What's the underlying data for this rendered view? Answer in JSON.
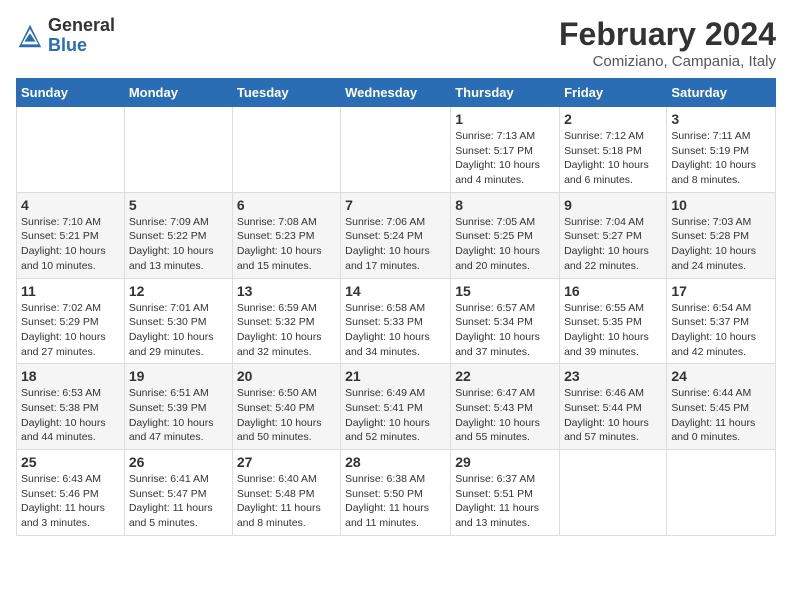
{
  "logo": {
    "general": "General",
    "blue": "Blue"
  },
  "header": {
    "title": "February 2024",
    "subtitle": "Comiziano, Campania, Italy"
  },
  "weekdays": [
    "Sunday",
    "Monday",
    "Tuesday",
    "Wednesday",
    "Thursday",
    "Friday",
    "Saturday"
  ],
  "weeks": [
    [
      {
        "day": "",
        "info": ""
      },
      {
        "day": "",
        "info": ""
      },
      {
        "day": "",
        "info": ""
      },
      {
        "day": "",
        "info": ""
      },
      {
        "day": "1",
        "info": "Sunrise: 7:13 AM\nSunset: 5:17 PM\nDaylight: 10 hours\nand 4 minutes."
      },
      {
        "day": "2",
        "info": "Sunrise: 7:12 AM\nSunset: 5:18 PM\nDaylight: 10 hours\nand 6 minutes."
      },
      {
        "day": "3",
        "info": "Sunrise: 7:11 AM\nSunset: 5:19 PM\nDaylight: 10 hours\nand 8 minutes."
      }
    ],
    [
      {
        "day": "4",
        "info": "Sunrise: 7:10 AM\nSunset: 5:21 PM\nDaylight: 10 hours\nand 10 minutes."
      },
      {
        "day": "5",
        "info": "Sunrise: 7:09 AM\nSunset: 5:22 PM\nDaylight: 10 hours\nand 13 minutes."
      },
      {
        "day": "6",
        "info": "Sunrise: 7:08 AM\nSunset: 5:23 PM\nDaylight: 10 hours\nand 15 minutes."
      },
      {
        "day": "7",
        "info": "Sunrise: 7:06 AM\nSunset: 5:24 PM\nDaylight: 10 hours\nand 17 minutes."
      },
      {
        "day": "8",
        "info": "Sunrise: 7:05 AM\nSunset: 5:25 PM\nDaylight: 10 hours\nand 20 minutes."
      },
      {
        "day": "9",
        "info": "Sunrise: 7:04 AM\nSunset: 5:27 PM\nDaylight: 10 hours\nand 22 minutes."
      },
      {
        "day": "10",
        "info": "Sunrise: 7:03 AM\nSunset: 5:28 PM\nDaylight: 10 hours\nand 24 minutes."
      }
    ],
    [
      {
        "day": "11",
        "info": "Sunrise: 7:02 AM\nSunset: 5:29 PM\nDaylight: 10 hours\nand 27 minutes."
      },
      {
        "day": "12",
        "info": "Sunrise: 7:01 AM\nSunset: 5:30 PM\nDaylight: 10 hours\nand 29 minutes."
      },
      {
        "day": "13",
        "info": "Sunrise: 6:59 AM\nSunset: 5:32 PM\nDaylight: 10 hours\nand 32 minutes."
      },
      {
        "day": "14",
        "info": "Sunrise: 6:58 AM\nSunset: 5:33 PM\nDaylight: 10 hours\nand 34 minutes."
      },
      {
        "day": "15",
        "info": "Sunrise: 6:57 AM\nSunset: 5:34 PM\nDaylight: 10 hours\nand 37 minutes."
      },
      {
        "day": "16",
        "info": "Sunrise: 6:55 AM\nSunset: 5:35 PM\nDaylight: 10 hours\nand 39 minutes."
      },
      {
        "day": "17",
        "info": "Sunrise: 6:54 AM\nSunset: 5:37 PM\nDaylight: 10 hours\nand 42 minutes."
      }
    ],
    [
      {
        "day": "18",
        "info": "Sunrise: 6:53 AM\nSunset: 5:38 PM\nDaylight: 10 hours\nand 44 minutes."
      },
      {
        "day": "19",
        "info": "Sunrise: 6:51 AM\nSunset: 5:39 PM\nDaylight: 10 hours\nand 47 minutes."
      },
      {
        "day": "20",
        "info": "Sunrise: 6:50 AM\nSunset: 5:40 PM\nDaylight: 10 hours\nand 50 minutes."
      },
      {
        "day": "21",
        "info": "Sunrise: 6:49 AM\nSunset: 5:41 PM\nDaylight: 10 hours\nand 52 minutes."
      },
      {
        "day": "22",
        "info": "Sunrise: 6:47 AM\nSunset: 5:43 PM\nDaylight: 10 hours\nand 55 minutes."
      },
      {
        "day": "23",
        "info": "Sunrise: 6:46 AM\nSunset: 5:44 PM\nDaylight: 10 hours\nand 57 minutes."
      },
      {
        "day": "24",
        "info": "Sunrise: 6:44 AM\nSunset: 5:45 PM\nDaylight: 11 hours\nand 0 minutes."
      }
    ],
    [
      {
        "day": "25",
        "info": "Sunrise: 6:43 AM\nSunset: 5:46 PM\nDaylight: 11 hours\nand 3 minutes."
      },
      {
        "day": "26",
        "info": "Sunrise: 6:41 AM\nSunset: 5:47 PM\nDaylight: 11 hours\nand 5 minutes."
      },
      {
        "day": "27",
        "info": "Sunrise: 6:40 AM\nSunset: 5:48 PM\nDaylight: 11 hours\nand 8 minutes."
      },
      {
        "day": "28",
        "info": "Sunrise: 6:38 AM\nSunset: 5:50 PM\nDaylight: 11 hours\nand 11 minutes."
      },
      {
        "day": "29",
        "info": "Sunrise: 6:37 AM\nSunset: 5:51 PM\nDaylight: 11 hours\nand 13 minutes."
      },
      {
        "day": "",
        "info": ""
      },
      {
        "day": "",
        "info": ""
      }
    ]
  ]
}
